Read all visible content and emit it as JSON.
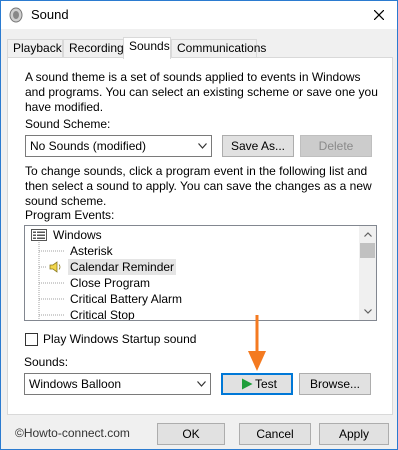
{
  "window": {
    "title": "Sound"
  },
  "tabs": [
    {
      "label": "Playback"
    },
    {
      "label": "Recording"
    },
    {
      "label": "Sounds"
    },
    {
      "label": "Communications"
    }
  ],
  "sounds_tab": {
    "intro_line1": "A sound theme is a set of sounds applied to events in Windows",
    "intro_line2": "and programs.  You can select an existing scheme or save one you",
    "intro_line3": "have modified.",
    "scheme_label": "Sound Scheme:",
    "scheme_value": "No Sounds (modified)",
    "save_as_label": "Save As...",
    "delete_label": "Delete",
    "change_line1": "To change sounds, click a program event in the following list and",
    "change_line2": "then select a sound to apply.  You can save the changes as a new",
    "change_line3": "sound scheme.",
    "program_events_label": "Program Events:",
    "events": [
      {
        "label": "Windows"
      },
      {
        "label": "Asterisk"
      },
      {
        "label": "Calendar Reminder"
      },
      {
        "label": "Close Program"
      },
      {
        "label": "Critical Battery Alarm"
      },
      {
        "label": "Critical Stop"
      }
    ],
    "startup_label": "Play Windows Startup sound",
    "sounds_label": "Sounds:",
    "sound_value": "Windows Balloon",
    "test_label": "Test",
    "browse_label": "Browse..."
  },
  "footer": {
    "watermark": "©Howto-connect.com",
    "ok_label": "OK",
    "cancel_label": "Cancel",
    "apply_label": "Apply"
  },
  "colors": {
    "accent": "#0078d7",
    "highlight_arrow": "#f47a20",
    "play_green": "#1f9e3a"
  },
  "icons": {
    "title": "speaker-icon",
    "close": "close-icon",
    "events_folder": "windows-events-icon",
    "selected_event": "speaker-icon",
    "play": "play-icon"
  }
}
